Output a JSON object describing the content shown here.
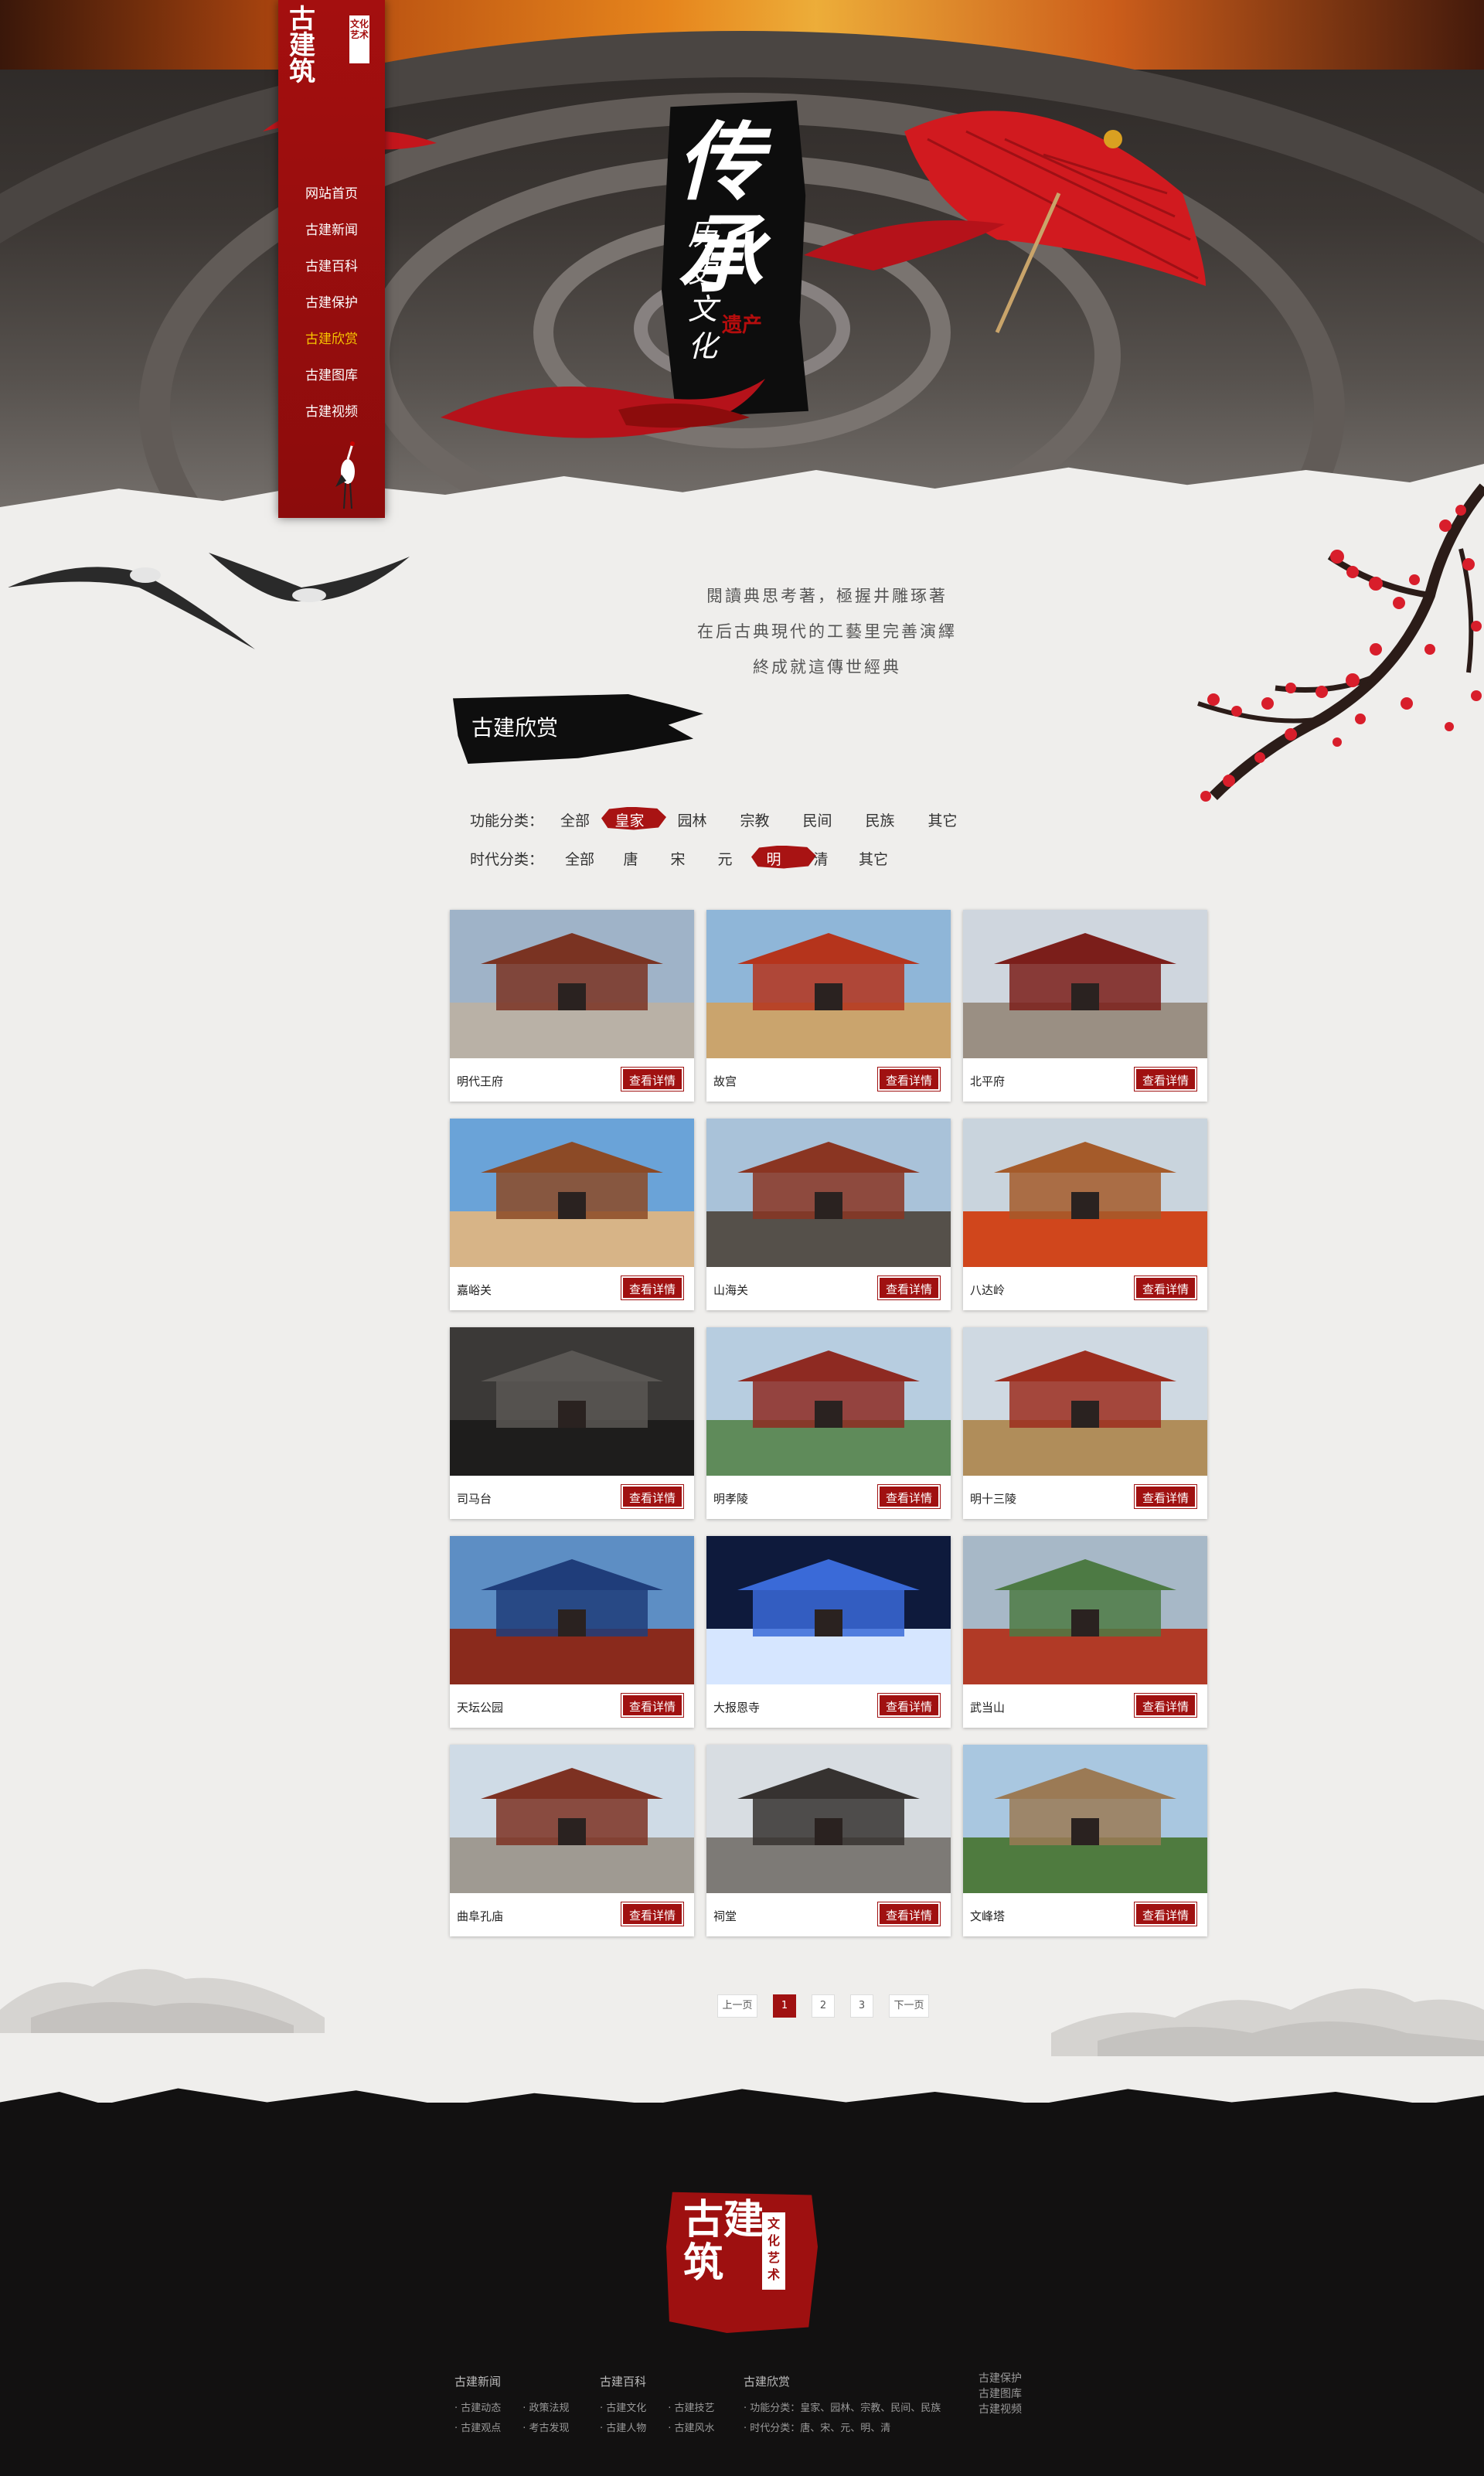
{
  "nav": {
    "logo_text": "古建筑",
    "logo_seal": "文化艺术",
    "items": [
      {
        "label": "网站首页"
      },
      {
        "label": "古建新闻"
      },
      {
        "label": "古建百科"
      },
      {
        "label": "古建保护"
      },
      {
        "label": "古建欣赏",
        "active": true
      },
      {
        "label": "古建图库"
      },
      {
        "label": "古建视频"
      }
    ]
  },
  "hero": {
    "calli_main": "传承",
    "calli_sub": "历史文化",
    "calli_tag": "遗产"
  },
  "poem": {
    "line1": "閱讀典思考著，極握井雕琢著",
    "line2": "在后古典現代的工藝里完善演繹",
    "line3": "終成就這傳世經典"
  },
  "section": {
    "title": "古建欣赏"
  },
  "filters": {
    "function": {
      "label": "功能分类：",
      "options": [
        "全部",
        "皇家",
        "园林",
        "宗教",
        "民间",
        "民族",
        "其它"
      ],
      "selected": "皇家"
    },
    "era": {
      "label": "时代分类：",
      "options": [
        "全部",
        "唐",
        "宋",
        "元",
        "明",
        "清",
        "其它"
      ],
      "selected": "明"
    }
  },
  "cards": {
    "button_label": "查看详情",
    "items": [
      {
        "name": "明代王府"
      },
      {
        "name": "故宫"
      },
      {
        "name": "北平府"
      },
      {
        "name": "嘉峪关"
      },
      {
        "name": "山海关"
      },
      {
        "name": "八达岭"
      },
      {
        "name": "司马台"
      },
      {
        "name": "明孝陵"
      },
      {
        "name": "明十三陵"
      },
      {
        "name": "天坛公园"
      },
      {
        "name": "大报恩寺"
      },
      {
        "name": "武当山"
      },
      {
        "name": "曲阜孔庙"
      },
      {
        "name": "祠堂"
      },
      {
        "name": "文峰塔"
      }
    ]
  },
  "pager": {
    "prev": "上一页",
    "pages": [
      "1",
      "2",
      "3"
    ],
    "current": "1",
    "next": "下一页"
  },
  "footer": {
    "seal_text": "古建筑",
    "seal_side": "文化艺术",
    "col1": {
      "title": "古建新闻",
      "links": [
        "· 古建动态",
        "· 政策法规",
        "· 古建观点",
        "· 考古发现"
      ]
    },
    "col2": {
      "title": "古建百科",
      "links": [
        "· 古建文化",
        "· 古建技艺",
        "· 古建人物",
        "· 古建风水"
      ]
    },
    "col3": {
      "title": "古建欣赏",
      "line1": "· 功能分类：皇家、园林、宗教、民间、民族",
      "line2": "· 时代分类：唐、宋、元、明、清"
    },
    "col4": [
      "古建保护",
      "古建图库",
      "古建视频"
    ]
  },
  "colors": {
    "brand_red": "#a01111",
    "nav_active": "#f7c500",
    "footer_bg": "#121111"
  }
}
